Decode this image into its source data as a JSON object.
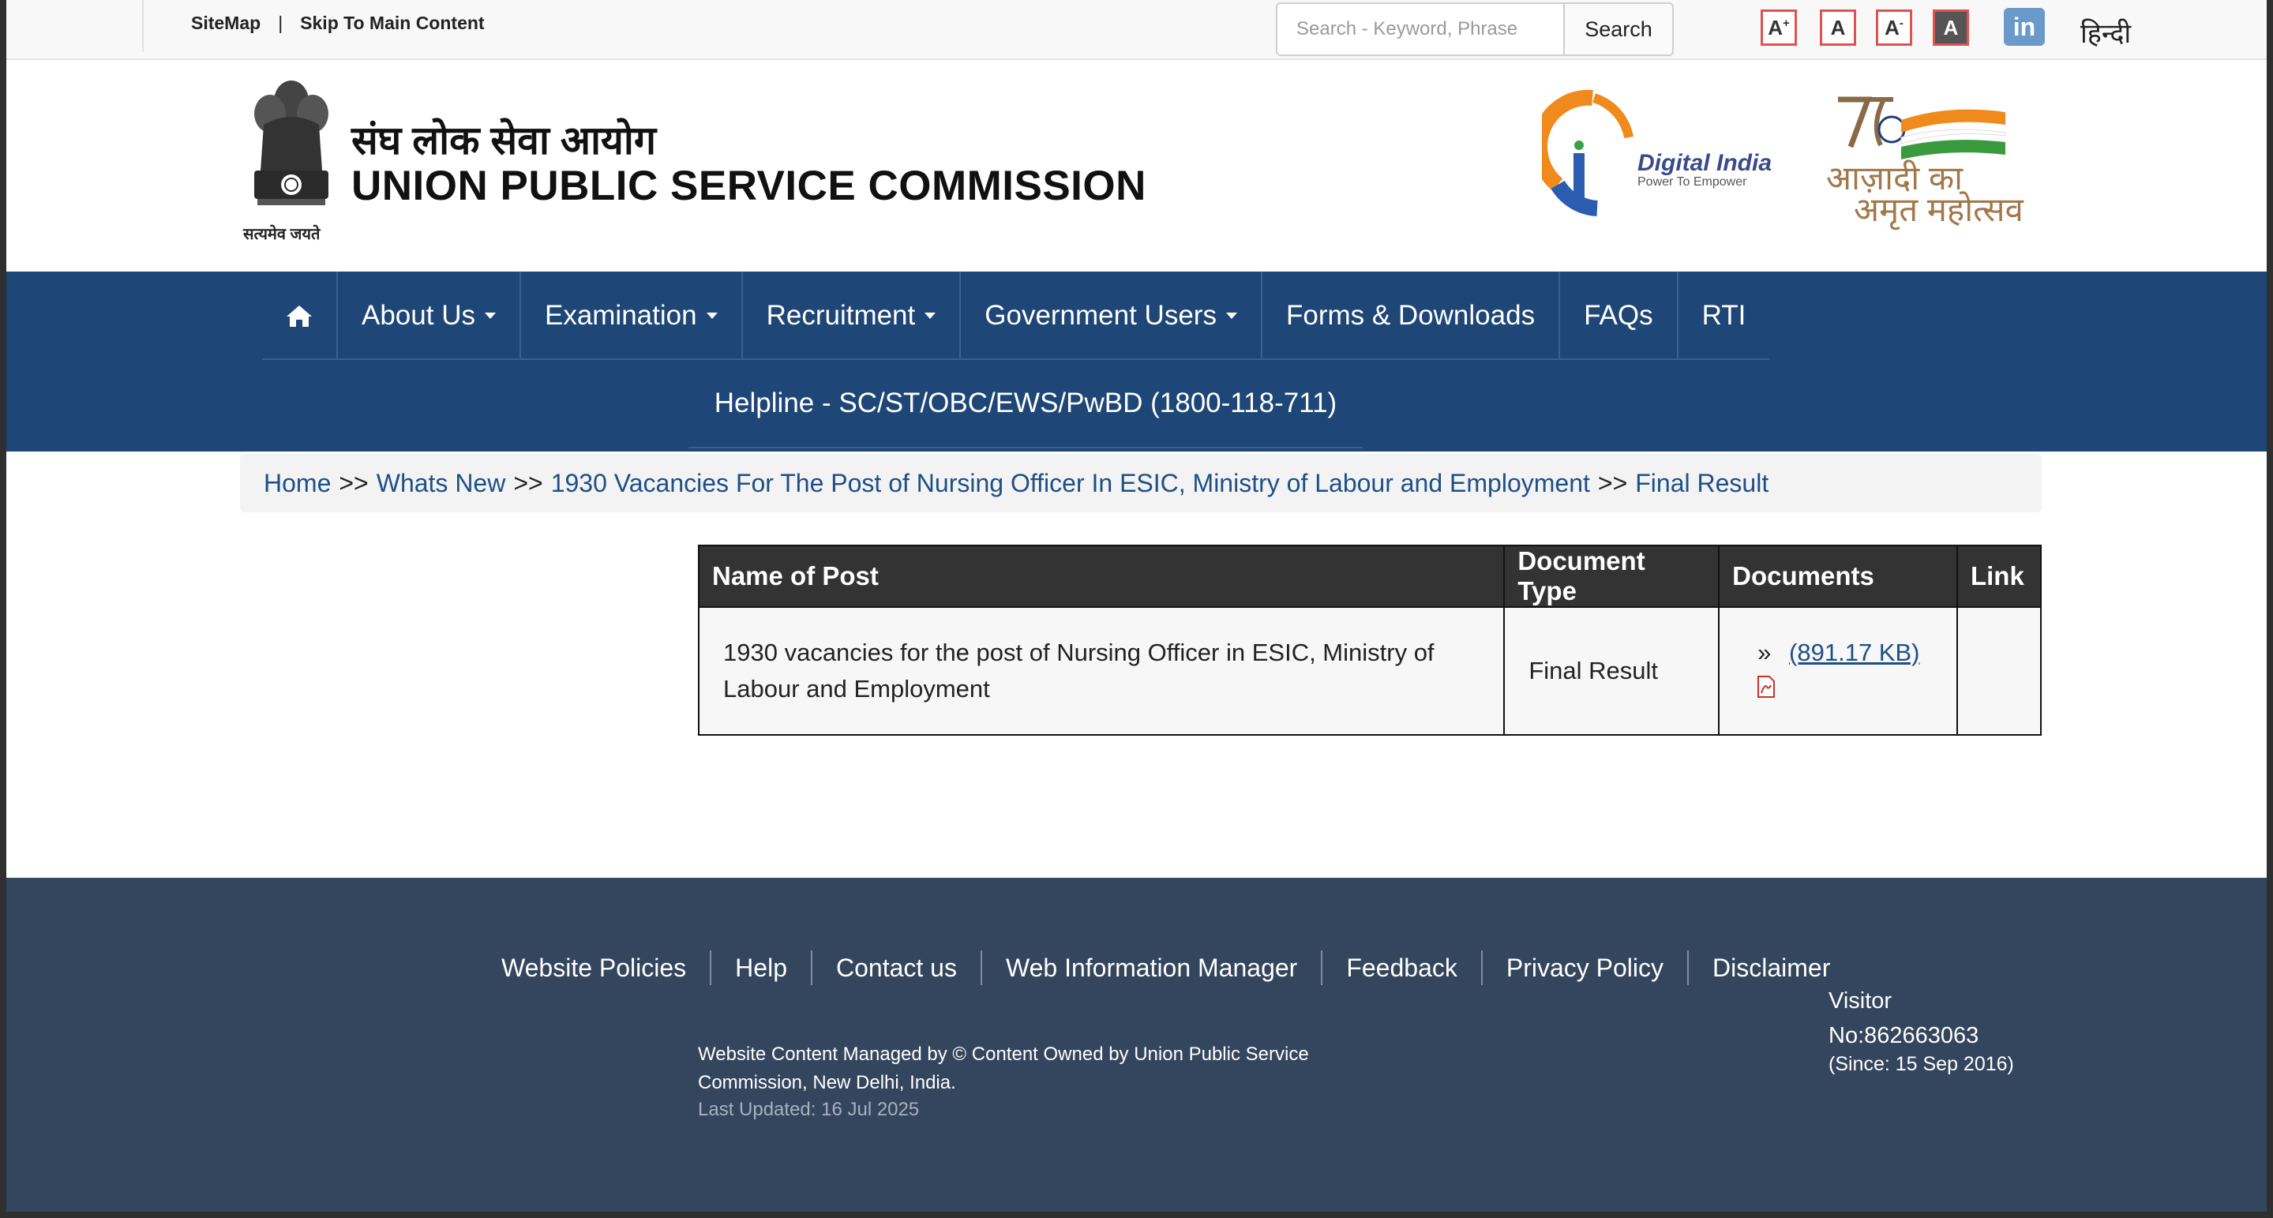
{
  "topbar": {
    "sitemap": "SiteMap",
    "separator": "|",
    "skip": "Skip To Main Content",
    "search_placeholder": "Search - Keyword, Phrase",
    "search_button": "Search",
    "font_increase": "A",
    "font_increase_sup": "+",
    "font_normal": "A",
    "font_decrease": "A",
    "font_decrease_sup": "-",
    "font_contrast": "A",
    "linkedin": "in",
    "language": "हिन्दी"
  },
  "header": {
    "emblem_caption": "सत्यमेव जयते",
    "title_hindi": "संघ लोक सेवा आयोग",
    "title_english": "UNION PUBLIC SERVICE COMMISSION",
    "digital_india": "Digital India",
    "digital_india_tagline": "Power To Empower",
    "azadi_line1": "आज़ादी का",
    "azadi_line2": "अमृत महोत्सव"
  },
  "nav": {
    "items": [
      {
        "label": "About Us"
      },
      {
        "label": "Examination"
      },
      {
        "label": "Recruitment"
      },
      {
        "label": "Government Users"
      },
      {
        "label": "Forms & Downloads"
      },
      {
        "label": "FAQs"
      },
      {
        "label": "RTI"
      }
    ],
    "helpline": "Helpline - SC/ST/OBC/EWS/PwBD (1800-118-711)"
  },
  "breadcrumb": {
    "sep": ">>",
    "items": [
      "Home",
      "Whats New",
      "1930 Vacancies For The Post of Nursing Officer In ESIC, Ministry of Labour and Employment",
      "Final Result"
    ]
  },
  "table": {
    "headers": [
      "Name of Post",
      "Document Type",
      "Documents",
      "Link"
    ],
    "rows": [
      {
        "name": "1930 vacancies for the post of Nursing Officer in ESIC, Ministry of Labour and Employment",
        "doc_type": "Final Result",
        "doc_prefix": "»",
        "doc_size": "(891.17 KB)",
        "link": ""
      }
    ]
  },
  "footer": {
    "links": [
      "Website Policies",
      "Help",
      "Contact us",
      "Web Information Manager",
      "Feedback",
      "Privacy Policy",
      "Disclaimer"
    ],
    "owned": "Website Content Managed by © Content Owned by Union Public Service Commission, New Delhi, India.",
    "last_updated": "Last Updated: 16 Jul 2025",
    "visitor": "Visitor No:862663063",
    "since": "(Since: 15 Sep 2016)"
  },
  "colors": {
    "nav_bg": "#1e4676",
    "footer_bg": "#34465e",
    "link": "#1e4f86",
    "table_header_bg": "#333333"
  }
}
